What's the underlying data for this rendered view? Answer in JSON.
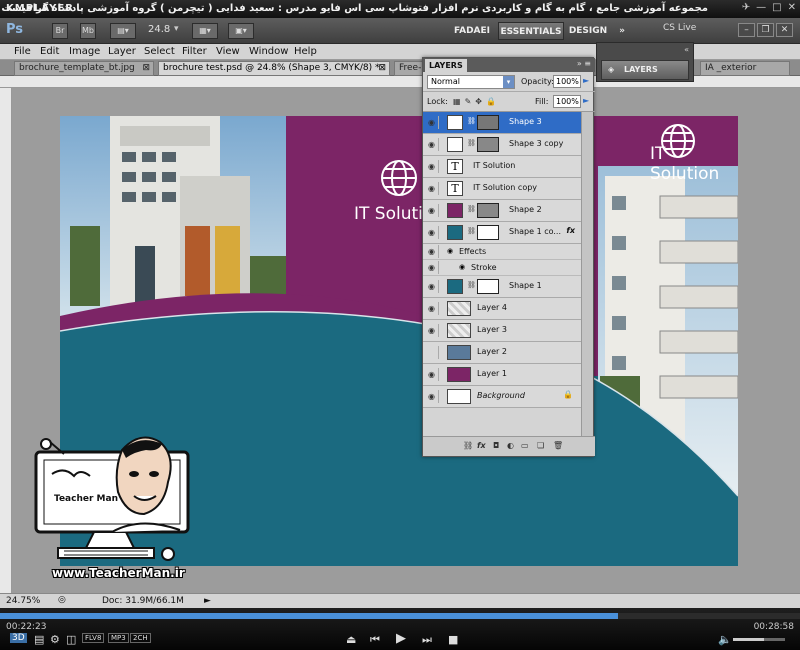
{
  "player": {
    "logo": "KMPLAYER",
    "caption": "مجموعه آموزشی جامع ، گام به گام و کاربردی نرم افزار فتوشاپ سی اس فایو  مدرس : سعید فدایی ( تیچرمن ) گروه آموزشی پادشاه گرافیست ها",
    "time_current": "00:22:23",
    "time_total": "00:28:58",
    "progress": 0.773,
    "volume": 0.6,
    "format_badges": [
      "FLV8",
      "MP3",
      "2CH"
    ]
  },
  "appbar": {
    "logo": "Ps",
    "bridge": "Br",
    "minibridge": "Mb",
    "zoom": "24.8",
    "workspaces": [
      "FADAEI",
      "ESSENTIALS",
      "DESIGN"
    ],
    "active_workspace": "ESSENTIALS",
    "more": "»",
    "cslive": "CS Live"
  },
  "menu": [
    "File",
    "Edit",
    "Image",
    "Layer",
    "Select",
    "Filter",
    "View",
    "Window",
    "Help"
  ],
  "tabs": [
    {
      "label": "brochure_template_bt.jpg",
      "active": false
    },
    {
      "label": "brochure test.psd @ 24.8% (Shape 3, CMYK/8) *",
      "active": true
    },
    {
      "label": "Free-",
      "active": false
    },
    {
      "label": "IA _exterior",
      "active": false
    }
  ],
  "canvas": {
    "heading_left": "IT Solution",
    "heading_right": "IT Solution"
  },
  "layers_panel": {
    "title": "LAYERS",
    "blend_mode": "Normal",
    "opacity_label": "Opacity:",
    "opacity": "100%",
    "lock_label": "Lock:",
    "fill_label": "Fill:",
    "fill": "100%",
    "layers": [
      {
        "name": "Shape 3",
        "selected": true,
        "type": "shape",
        "fx": false
      },
      {
        "name": "Shape 3 copy",
        "selected": false,
        "type": "shape",
        "fx": false
      },
      {
        "name": "IT Solution",
        "selected": false,
        "type": "text",
        "fx": false
      },
      {
        "name": "IT Solution copy",
        "selected": false,
        "type": "text",
        "fx": false
      },
      {
        "name": "Shape 2",
        "selected": false,
        "type": "shape",
        "fx": false
      },
      {
        "name": "Shape 1 co...",
        "selected": false,
        "type": "shape",
        "fx": true
      },
      {
        "name": "Effects",
        "selected": false,
        "type": "sub",
        "fx": false
      },
      {
        "name": "Stroke",
        "selected": false,
        "type": "sub",
        "fx": false
      },
      {
        "name": "Shape 1",
        "selected": false,
        "type": "shape",
        "fx": false
      },
      {
        "name": "Layer 4",
        "selected": false,
        "type": "pixel",
        "fx": false
      },
      {
        "name": "Layer 3",
        "selected": false,
        "type": "pixel",
        "fx": false
      },
      {
        "name": "Layer 2",
        "selected": false,
        "type": "pixel",
        "fx": false
      },
      {
        "name": "Layer 1",
        "selected": false,
        "type": "pixel",
        "fx": false
      },
      {
        "name": "Background",
        "selected": false,
        "type": "background",
        "fx": false
      }
    ],
    "fx_label": "fx"
  },
  "dock": {
    "label": "LAYERS"
  },
  "status": {
    "zoom": "24.75%",
    "doc": "Doc: 31.9M/66.1M"
  },
  "branding": {
    "logo_text": "Teacher Man",
    "url": "www.TeacherMan.ir"
  },
  "colors": {
    "purple": "#7c2566",
    "teal": "#1b6a80",
    "selection": "#2f6cc6"
  }
}
